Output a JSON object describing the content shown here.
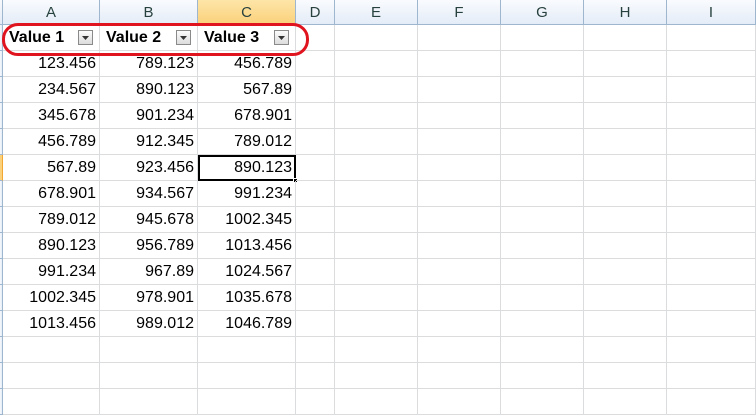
{
  "sheet": {
    "columns": [
      "A",
      "B",
      "C",
      "D",
      "E",
      "F",
      "G",
      "H",
      "I"
    ],
    "selected_column": "C",
    "headers": [
      "Value 1",
      "Value 2",
      "Value 3"
    ],
    "rows": [
      [
        "123.456",
        "789.123",
        "456.789"
      ],
      [
        "234.567",
        "890.123",
        "567.89"
      ],
      [
        "345.678",
        "901.234",
        "678.901"
      ],
      [
        "456.789",
        "912.345",
        "789.012"
      ],
      [
        "567.89",
        "923.456",
        "890.123"
      ],
      [
        "678.901",
        "934.567",
        "991.234"
      ],
      [
        "789.012",
        "945.678",
        "1002.345"
      ],
      [
        "890.123",
        "956.789",
        "1013.456"
      ],
      [
        "991.234",
        "967.89",
        "1024.567"
      ],
      [
        "1002.345",
        "978.901",
        "1035.678"
      ],
      [
        "1013.456",
        "989.012",
        "1046.789"
      ]
    ],
    "active_cell": {
      "row": 5,
      "column": "C"
    }
  },
  "icons": {
    "filter": "filter-dropdown-icon"
  },
  "colors": {
    "highlight_ring": "#e0141e",
    "selected_header": "#fbd17b",
    "gridline": "#dadcdd",
    "header_border": "#9eb6ce"
  }
}
